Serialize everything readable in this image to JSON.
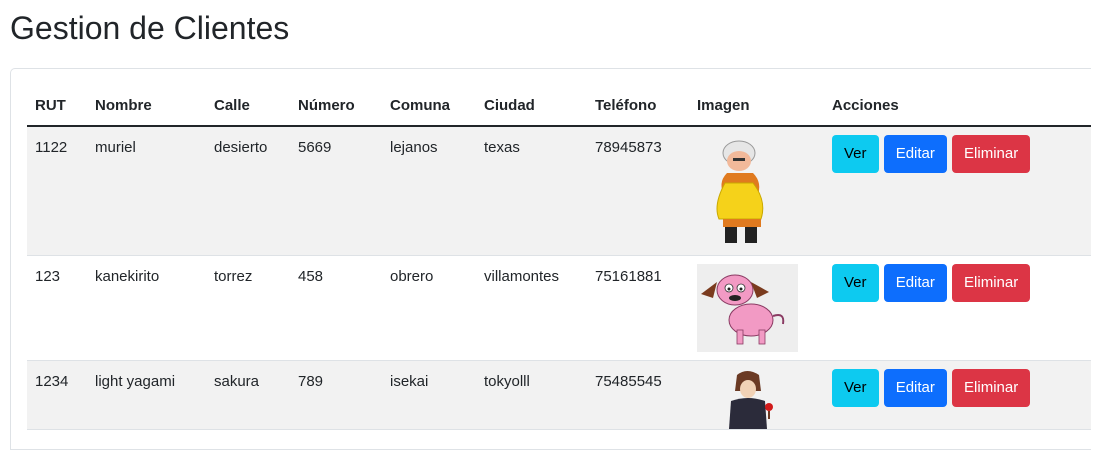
{
  "header": {
    "title": "Gestion de Clientes"
  },
  "table": {
    "columns": [
      "RUT",
      "Nombre",
      "Calle",
      "Número",
      "Comuna",
      "Ciudad",
      "Teléfono",
      "Imagen",
      "Acciones"
    ],
    "rows": [
      {
        "rut": "1122",
        "nombre": "muriel",
        "calle": "desierto",
        "numero": "5669",
        "comuna": "lejanos",
        "ciudad": "texas",
        "telefono": "78945873",
        "image": "muriel-image"
      },
      {
        "rut": "123",
        "nombre": "kanekirito",
        "calle": "torrez",
        "numero": "458",
        "comuna": "obrero",
        "ciudad": "villamontes",
        "telefono": "75161881",
        "image": "courage-dog-image"
      },
      {
        "rut": "1234",
        "nombre": "light yagami",
        "calle": "sakura",
        "numero": "789",
        "comuna": "isekai",
        "ciudad": "tokyolll",
        "telefono": "75485545",
        "image": "light-yagami-image"
      }
    ],
    "actions": {
      "ver": "Ver",
      "editar": "Editar",
      "eliminar": "Eliminar"
    }
  },
  "colors": {
    "ver": "#0dcaf0",
    "editar": "#0d6efd",
    "eliminar": "#dc3545",
    "striped_row": "#f2f2f2"
  }
}
